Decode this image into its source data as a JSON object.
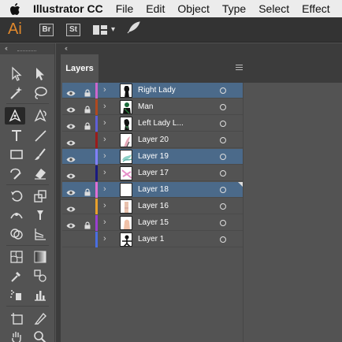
{
  "menubar": {
    "apple_icon": "apple-icon",
    "app_name": "Illustrator CC",
    "items": [
      "File",
      "Edit",
      "Object",
      "Type",
      "Select",
      "Effect"
    ]
  },
  "appbar": {
    "logo": "Ai",
    "bridge_badge": "Br",
    "stock_badge": "St"
  },
  "layers_panel": {
    "tab_label": "Layers",
    "layers": [
      {
        "name": "Right Lady",
        "visible": true,
        "locked": true,
        "color": "#cc66cc",
        "selected": true,
        "thumb": "lady-right"
      },
      {
        "name": "Man",
        "visible": true,
        "locked": true,
        "color": "#b0491f",
        "selected": false,
        "thumb": "man"
      },
      {
        "name": "Left Lady L...",
        "visible": true,
        "locked": true,
        "color": "#5f5fd6",
        "selected": false,
        "thumb": "lady-left"
      },
      {
        "name": "Layer 20",
        "visible": true,
        "locked": false,
        "color": "#9b1c1c",
        "selected": false,
        "thumb": "layer20"
      },
      {
        "name": "Layer 19",
        "visible": true,
        "locked": false,
        "color": "#8080ff",
        "selected": true,
        "thumb": "layer19"
      },
      {
        "name": "Layer 17",
        "visible": true,
        "locked": false,
        "color": "#1a1a80",
        "selected": false,
        "thumb": "layer17"
      },
      {
        "name": "Layer 18",
        "visible": true,
        "locked": true,
        "color": "#e06fd5",
        "selected": true,
        "thumb": "layer18"
      },
      {
        "name": "Layer 16",
        "visible": true,
        "locked": false,
        "color": "#e8a02c",
        "selected": false,
        "thumb": "layer16"
      },
      {
        "name": "Layer 15",
        "visible": true,
        "locked": true,
        "color": "#9a3fd1",
        "selected": false,
        "thumb": "layer15"
      },
      {
        "name": "Layer 1",
        "visible": false,
        "locked": false,
        "color": "#4a6ee0",
        "selected": false,
        "thumb": "layer1"
      }
    ]
  },
  "colors": {
    "selected_row": "#4b6a8a",
    "panel_bg": "#535353",
    "accent_logo": "#e0882c"
  }
}
